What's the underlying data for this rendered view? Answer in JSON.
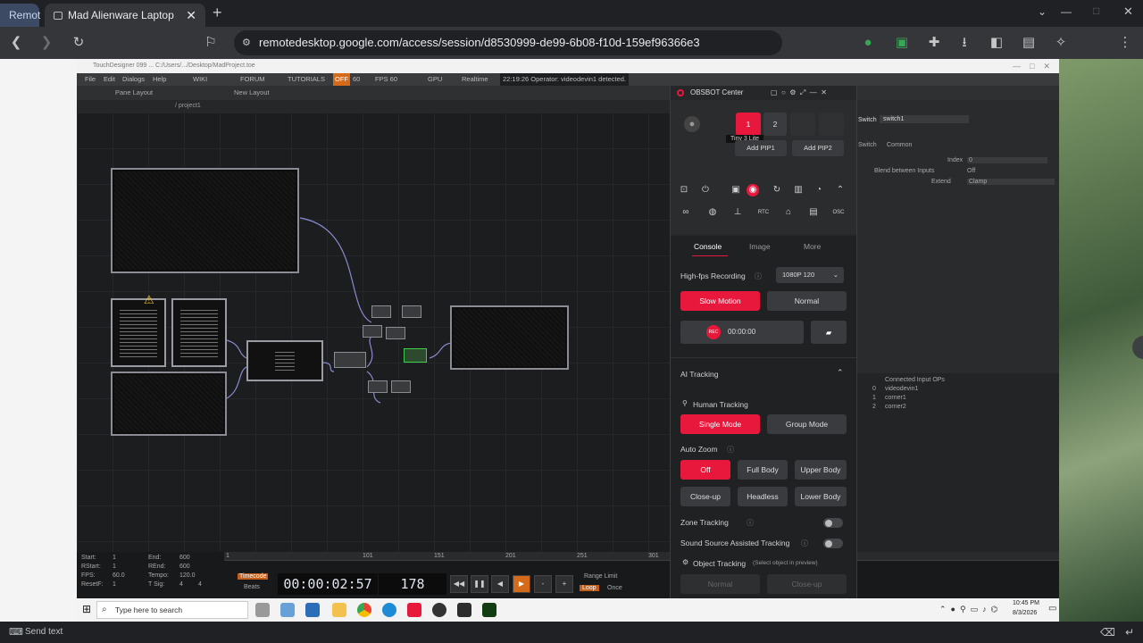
{
  "browser": {
    "tabs": [
      {
        "label": "Remot"
      },
      {
        "label": "Mad Alienware Laptop"
      }
    ],
    "url": "remotedesktop.google.com/access/session/d8530999-de99-6b08-f10d-159ef96366e3",
    "new_tab": "+",
    "window_controls": {
      "minimize": "—",
      "maximize": "□",
      "close": "✕"
    },
    "bottom_bar": {
      "send_text": "Send text"
    }
  },
  "touchdesigner": {
    "title": "TouchDesigner 099 ... C:/Users/.../Desktop/MadProject.toe",
    "menu": [
      "File",
      "Edit",
      "Dialogs",
      "Help",
      "WIKI",
      "FORUM",
      "TUTORIALS",
      "OFF",
      "60",
      "FPS 60",
      "GPU",
      "Realtime"
    ],
    "status_message": "22:19:26 Operator: videodevin1 detected.",
    "pane_layout_label": "Pane Layout",
    "new_layout_label": "New Layout",
    "path": "/ project1",
    "params": {
      "op_type": "Switch",
      "op_name": "switch1",
      "tabs": [
        "Switch",
        "Common"
      ],
      "rows": [
        {
          "label": "Index",
          "value": "0"
        },
        {
          "label": "Blend between Inputs",
          "value": "Off"
        },
        {
          "label": "Extend",
          "value": "Clamp"
        }
      ],
      "inputs_header": "Connected Input OPs",
      "inputs": [
        {
          "index": "0",
          "name": "videodevin1"
        },
        {
          "index": "1",
          "name": "corner1"
        },
        {
          "index": "2",
          "name": "corner2"
        }
      ]
    },
    "timeline": {
      "start": "1",
      "end": "600",
      "rstart": "1",
      "rend": "600",
      "fps": "60.0",
      "tempo": "120.0",
      "resetf": "1",
      "tsig_a": "4",
      "tsig_b": "4",
      "labels": {
        "start": "Start:",
        "end": "End:",
        "rstart": "RStart:",
        "rend": "REnd:",
        "fps": "FPS:",
        "tempo": "Tempo:",
        "resetf": "ResetF:",
        "tsig": "T Sig:"
      },
      "mode_timecode": "Timecode",
      "mode_beats": "Beats",
      "timecode": "00:00:02:57",
      "frame": "178",
      "range_limit": "Range Limit",
      "loop": "Loop",
      "once": "Once",
      "ticks": [
        "1",
        "101",
        "151",
        "201",
        "251",
        "301"
      ]
    }
  },
  "obsbot": {
    "title": "OBSBOT Center",
    "device_slots": [
      "1",
      "2",
      "",
      ""
    ],
    "tooltip": "Tiny 3 Lite",
    "add_pip1": "Add PIP1",
    "add_pip2": "Add PIP2",
    "tabs": [
      "Console",
      "Image",
      "More"
    ],
    "high_fps_label": "High-fps Recording",
    "high_fps_value": "1080P 120",
    "slow_motion": "Slow Motion",
    "normal": "Normal",
    "rec_label": "REC",
    "rec_time": "00:00:00",
    "ai_tracking": "AI Tracking",
    "human_tracking": "Human Tracking",
    "single_mode": "Single Mode",
    "group_mode": "Group Mode",
    "auto_zoom": "Auto Zoom",
    "zoom_options": [
      "Off",
      "Full Body",
      "Upper Body",
      "Close-up",
      "Headless",
      "Lower Body"
    ],
    "zone_tracking": "Zone Tracking",
    "sound_source": "Sound Source Assisted Tracking",
    "object_tracking": "Object Tracking",
    "object_hint": "(Select object in preview)",
    "bottom_normal": "Normal",
    "bottom_closeup": "Close-up"
  },
  "windows_taskbar": {
    "search_placeholder": "Type here to search",
    "time": "10:45 PM",
    "date": "8/3/2026"
  }
}
